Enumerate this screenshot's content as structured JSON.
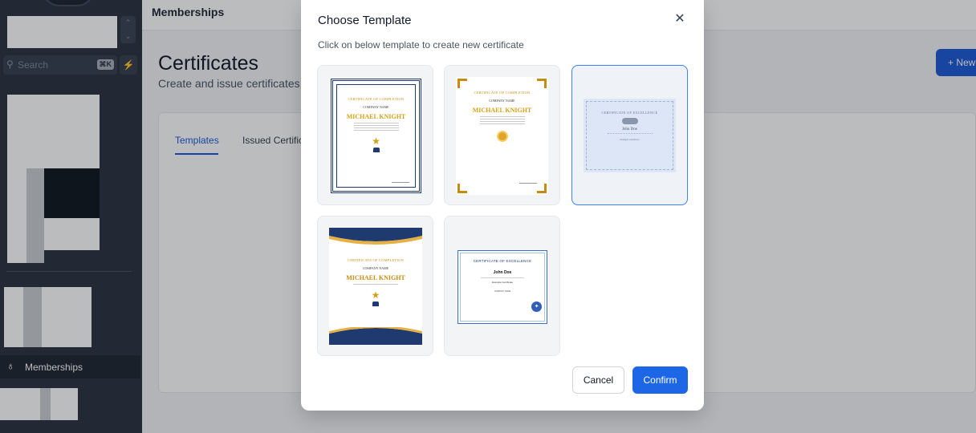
{
  "sidebar": {
    "search_placeholder": "Search",
    "search_shortcut": "⌘K",
    "active_item": {
      "label": "Memberships",
      "icon": "award-icon"
    }
  },
  "topbar": {
    "title": "Memberships"
  },
  "page": {
    "title": "Certificates",
    "subtitle": "Create and issue certificates",
    "new_button": "+ New"
  },
  "tabs": [
    {
      "label": "Templates",
      "active": true
    },
    {
      "label": "Issued Certificates",
      "active": false
    }
  ],
  "modal": {
    "title": "Choose Template",
    "subtitle": "Click on below template to create new certificate",
    "close_icon": "close-icon",
    "cancel_label": "Cancel",
    "confirm_label": "Confirm",
    "templates": [
      {
        "title": "CERTIFICATE OF COMPLETION",
        "company": "COMPANY NAME",
        "name": "MICHAEL KNIGHT",
        "emblem": "trophy",
        "selected": false
      },
      {
        "title": "CERTIFICATE OF COMPLETION",
        "company": "COMPANY NAME",
        "name": "MICHAEL KNIGHT",
        "emblem": "medal",
        "selected": false
      },
      {
        "title": "CERTIFICATE OF EXCELLENCE",
        "name": "John Doe",
        "course": "Example Certificate",
        "selected": true
      },
      {
        "title": "CERTIFICATE OF COMPLETION",
        "company": "COMPANY NAME",
        "name": "MICHAEL KNIGHT",
        "emblem": "trophy",
        "selected": false
      },
      {
        "title": "CERTIFICATE OF EXCELLENCE",
        "name": "John Doe",
        "course": "Example Certificate",
        "company": "COMPANY NAME",
        "selected": false
      }
    ]
  },
  "colors": {
    "sidebar_bg": "#2b3440",
    "accent": "#1d66e5",
    "gold": "#d4a017",
    "navy": "#1e3a6e"
  }
}
